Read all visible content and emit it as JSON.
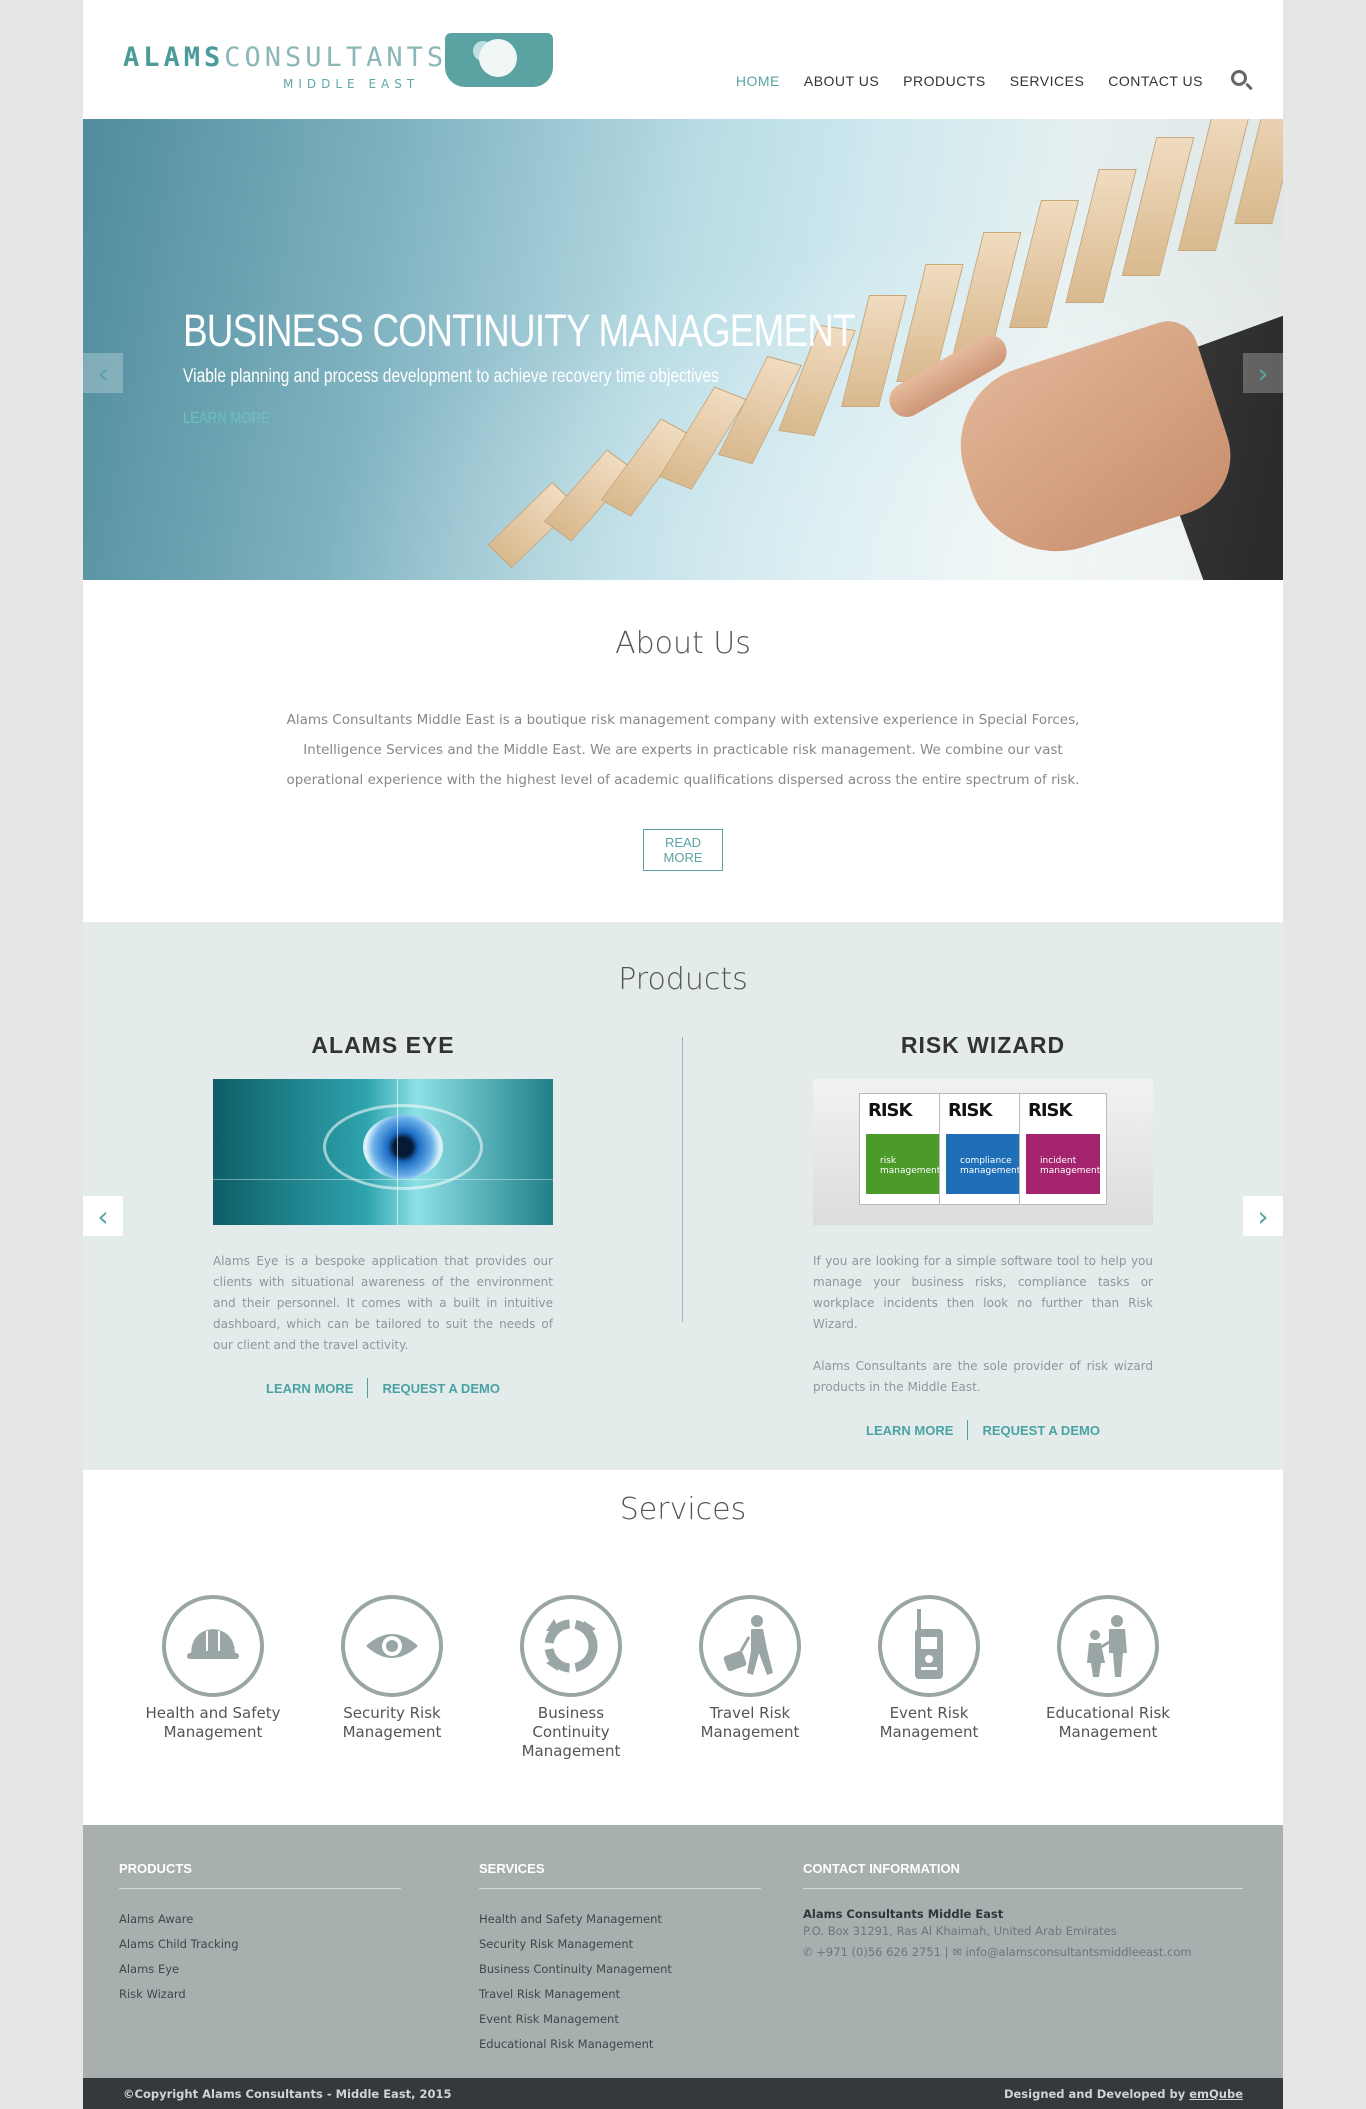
{
  "header": {
    "logo_main": "ALAMS",
    "logo_light": "CONSULTANT",
    "logo_end": "S",
    "logo_sub": "MIDDLE EAST",
    "nav": [
      "HOME",
      "ABOUT US",
      "PRODUCTS",
      "SERVICES",
      "CONTACT US"
    ],
    "active_nav": "HOME",
    "search_icon": "search-icon"
  },
  "hero": {
    "title": "BUSINESS CONTINUITY MANAGEMENT",
    "subtitle": "Viable planning and process development to achieve recovery time objectives",
    "link": "LEARN MORE",
    "prev_arrow": "‹",
    "next_arrow": "›"
  },
  "about": {
    "title": "About Us",
    "text": "Alams Consultants Middle East is a boutique risk management company with extensive experience in Special Forces, Intelligence Services and the Middle East. We are experts in practicable risk management. We combine our vast operational experience with the highest level of academic qualifications dispersed across the entire spectrum of risk.",
    "button": "READ MORE"
  },
  "products": {
    "title": "Products",
    "prev_arrow": "‹",
    "next_arrow": "›",
    "items": [
      {
        "name": "ALAMS EYE",
        "paragraphs": [
          "Alams Eye is a bespoke application that provides our clients with situational awareness of the environment and their personnel. It comes with a built in intuitive dashboard, which can be tailored to suit the needs of our client and the travel activity."
        ],
        "learn_more": "LEARN MORE",
        "request_demo": "REQUEST A DEMO"
      },
      {
        "name": "RISK WIZARD",
        "paragraphs": [
          "If you are looking for a simple software tool to help you manage your business risks, compliance tasks or workplace incidents then look no further than Risk Wizard.",
          "Alams Consultants are the sole provider of risk wizard products in the Middle East."
        ],
        "learn_more": "LEARN MORE",
        "request_demo": "REQUEST A DEMO",
        "box_logo": "RISK",
        "boxes": [
          {
            "label": "risk management",
            "color": "#4c9a2a"
          },
          {
            "label": "compliance management",
            "color": "#1f6fb8"
          },
          {
            "label": "incident management",
            "color": "#a5246f"
          }
        ]
      }
    ]
  },
  "services": {
    "title": "Services",
    "items": [
      {
        "line1": "Health and Safety",
        "line2": "Management",
        "line3": "",
        "icon": "hard-hat-icon"
      },
      {
        "line1": "Security Risk",
        "line2": "Management",
        "line3": "",
        "icon": "eye-icon"
      },
      {
        "line1": "Business",
        "line2": "Continuity",
        "line3": "Management",
        "icon": "recycle-arrows-icon"
      },
      {
        "line1": "Travel Risk",
        "line2": "Management",
        "line3": "",
        "icon": "traveler-luggage-icon"
      },
      {
        "line1": "Event Risk",
        "line2": "Management",
        "line3": "",
        "icon": "walkie-talkie-icon"
      },
      {
        "line1": "Educational Risk",
        "line2": "Management",
        "line3": "",
        "icon": "parent-child-icon"
      }
    ]
  },
  "footer": {
    "products_head": "PRODUCTS",
    "products": [
      "Alams Aware",
      "Alams Child Tracking",
      "Alams Eye",
      "Risk Wizard"
    ],
    "services_head": "SERVICES",
    "services": [
      "Health and Safety Management",
      "Security Risk Management",
      "Business Continuity Management",
      "Travel Risk Management",
      "Event Risk Management",
      "Educational Risk Management"
    ],
    "contact_head": "CONTACT INFORMATION",
    "company": "Alams Consultants Middle East",
    "address": "P.O. Box 31291, Ras Al Khaimah, United Arab Emirates",
    "phone": "+971 (0)56 626 2751",
    "email": "info@alamsconsultantsmiddleeast.com",
    "copyright": "©Copyright Alams Consultants - Middle East, 2015",
    "credit_prefix": "Designed and Developed by",
    "credit_link": "emQube"
  },
  "colors": {
    "accent": "#5ba3a3",
    "products_bg": "#e3ebeb",
    "footer_bg": "#a7afaf",
    "bottom_bar": "#343a3c"
  }
}
